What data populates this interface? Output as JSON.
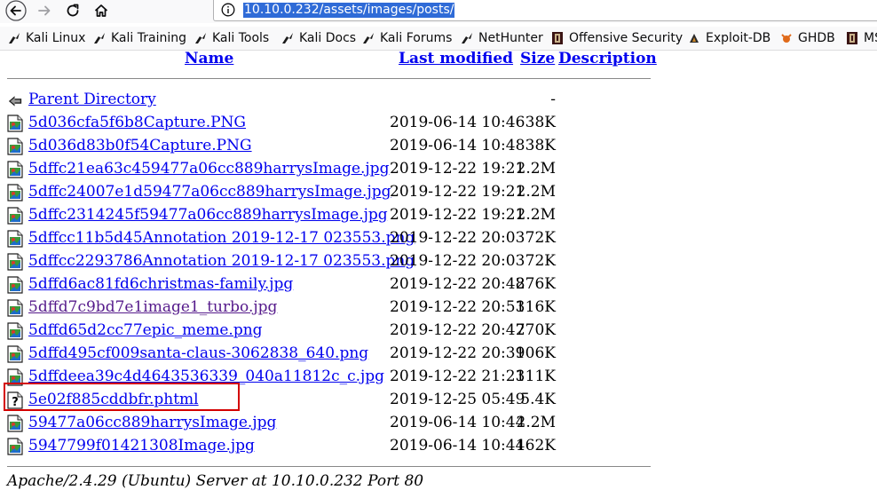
{
  "browser": {
    "url": "10.10.0.232/assets/images/posts/",
    "bookmarks": [
      {
        "label": "Kali Linux",
        "icon": "kali-dragon-icon"
      },
      {
        "label": "Kali Training",
        "icon": "kali-dragon-icon"
      },
      {
        "label": "Kali Tools",
        "icon": "kali-dragon-icon"
      },
      {
        "label": "Kali Docs",
        "icon": "kali-dragon-icon"
      },
      {
        "label": "Kali Forums",
        "icon": "kali-dragon-icon"
      },
      {
        "label": "NetHunter",
        "icon": "kali-dragon-icon"
      },
      {
        "label": "Offensive Security",
        "icon": "offsec-icon"
      },
      {
        "label": "Exploit-DB",
        "icon": "exploitdb-icon"
      },
      {
        "label": "GHDB",
        "icon": "ghdb-icon"
      },
      {
        "label": "MS",
        "icon": "offsec-icon"
      }
    ]
  },
  "listing": {
    "headers": {
      "name": "Name",
      "modified": "Last modified",
      "size": "Size",
      "description": "Description"
    },
    "parent": {
      "label": "Parent Directory",
      "size": "-"
    },
    "files": [
      {
        "name": "5d036cfa5f6b8Capture.PNG",
        "modified": "2019-06-14 10:46",
        "size": "38K",
        "icon": "image-file-icon"
      },
      {
        "name": "5d036d83b0f54Capture.PNG",
        "modified": "2019-06-14 10:48",
        "size": "38K",
        "icon": "image-file-icon"
      },
      {
        "name": "5dffc21ea63c459477a06cc889harrysImage.jpg",
        "modified": "2019-12-22 19:21",
        "size": "2.2M",
        "icon": "image-file-icon"
      },
      {
        "name": "5dffc24007e1d59477a06cc889harrysImage.jpg",
        "modified": "2019-12-22 19:21",
        "size": "2.2M",
        "icon": "image-file-icon"
      },
      {
        "name": "5dffc2314245f59477a06cc889harrysImage.jpg",
        "modified": "2019-12-22 19:21",
        "size": "2.2M",
        "icon": "image-file-icon"
      },
      {
        "name": "5dffcc11b5d45Annotation 2019-12-17 023553.png",
        "modified": "2019-12-22 20:03",
        "size": "72K",
        "icon": "image-file-icon"
      },
      {
        "name": "5dffcc2293786Annotation 2019-12-17 023553.png",
        "modified": "2019-12-22 20:03",
        "size": "72K",
        "icon": "image-file-icon"
      },
      {
        "name": "5dffd6ac81fd6christmas-family.jpg",
        "modified": "2019-12-22 20:48",
        "size": "276K",
        "icon": "image-file-icon"
      },
      {
        "name": "5dffd7c9bd7e1image1_turbo.jpg",
        "modified": "2019-12-22 20:53",
        "size": "116K",
        "icon": "image-file-icon",
        "visited": true
      },
      {
        "name": "5dffd65d2cc77epic_meme.png",
        "modified": "2019-12-22 20:47",
        "size": "270K",
        "icon": "image-file-icon"
      },
      {
        "name": "5dffd495cf009santa-claus-3062838_640.png",
        "modified": "2019-12-22 20:39",
        "size": "106K",
        "icon": "image-file-icon"
      },
      {
        "name": "5dffdeea39c4d4643536339_040a11812c_c.jpg",
        "modified": "2019-12-22 21:23",
        "size": "111K",
        "icon": "image-file-icon"
      },
      {
        "name": "5e02f885cddbfr.phtml",
        "modified": "2019-12-25 05:49",
        "size": "5.4K",
        "icon": "unknown-file-icon",
        "highlighted": true
      },
      {
        "name": "59477a06cc889harrysImage.jpg",
        "modified": "2019-06-14 10:44",
        "size": "2.2M",
        "icon": "image-file-icon"
      },
      {
        "name": "5947799f01421308Image.jpg",
        "modified": "2019-06-14 10:44",
        "size": "162K",
        "icon": "image-file-icon"
      }
    ],
    "footer": "Apache/2.4.29 (Ubuntu) Server at 10.10.0.232 Port 80"
  },
  "colors": {
    "link": "#0000ee",
    "visited": "#551a8b",
    "highlight": "#d40000",
    "url_selection": "#2f6bd7"
  }
}
